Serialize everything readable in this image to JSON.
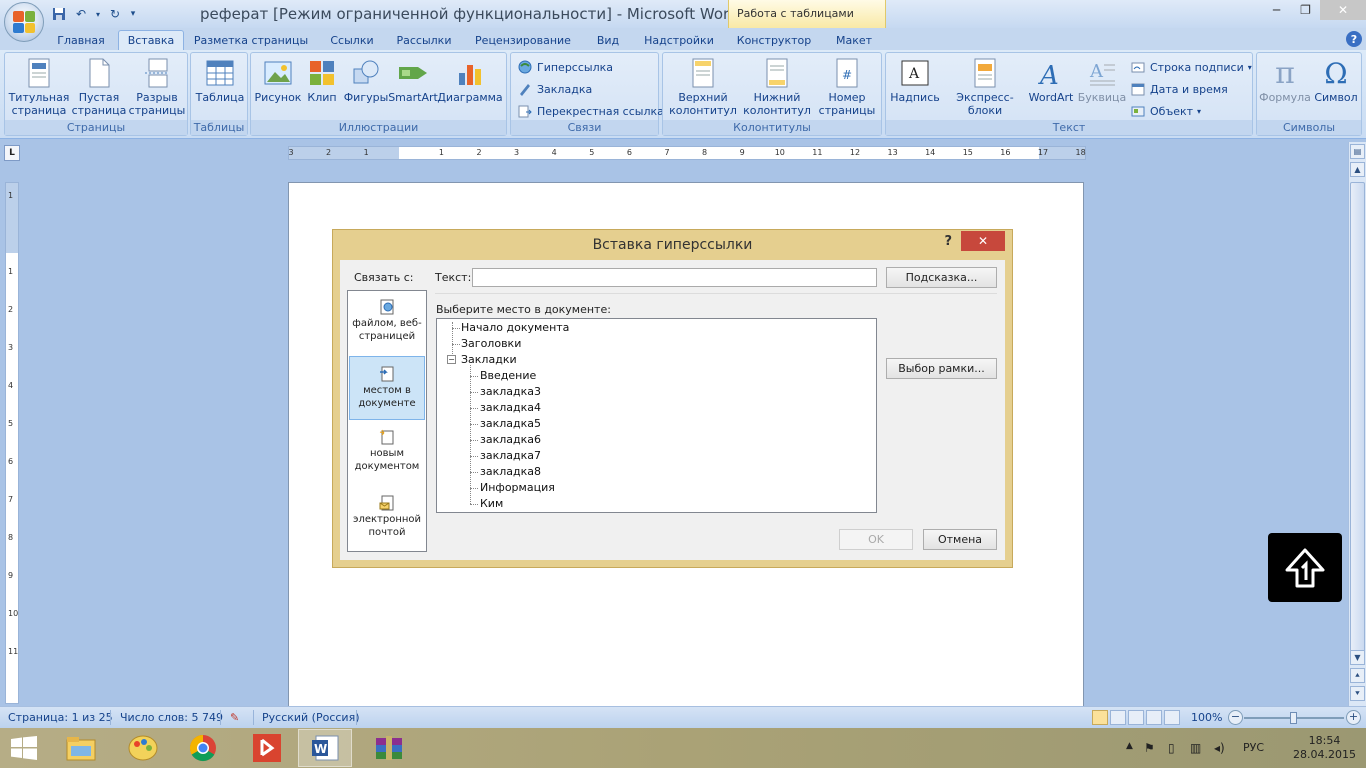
{
  "app": {
    "window_title": "реферат [Режим ограниченной функциональности]  -  Microsoft Word",
    "context_tab_group": "Работа с таблицами"
  },
  "tabs": [
    "Главная",
    "Вставка",
    "Разметка страницы",
    "Ссылки",
    "Рассылки",
    "Рецензирование",
    "Вид",
    "Надстройки",
    "Конструктор",
    "Макет"
  ],
  "ribbon": {
    "pages": {
      "label": "Страницы",
      "title_page": "Титульная\nстраница",
      "blank_page": "Пустая\nстраница",
      "page_break": "Разрыв\nстраницы"
    },
    "tables": {
      "label": "Таблицы",
      "table": "Таблица"
    },
    "illustrations": {
      "label": "Иллюстрации",
      "picture": "Рисунок",
      "clip": "Клип",
      "shapes": "Фигуры",
      "smartart": "SmartArt",
      "chart": "Диаграмма"
    },
    "links": {
      "label": "Связи",
      "hyperlink": "Гиперссылка",
      "bookmark": "Закладка",
      "cross_ref": "Перекрестная ссылка"
    },
    "header_footer": {
      "label": "Колонтитулы",
      "header": "Верхний\nколонтитул",
      "footer": "Нижний\nколонтитул",
      "page_number": "Номер\nстраницы"
    },
    "text": {
      "label": "Текст",
      "textbox": "Надпись",
      "quick_parts": "Экспресс-блоки",
      "wordart": "WordArt",
      "dropcap": "Буквица",
      "signature": "Строка подписи",
      "datetime": "Дата и время",
      "object": "Объект"
    },
    "symbols": {
      "label": "Символы",
      "equation": "Формула",
      "symbol": "Символ"
    }
  },
  "ruler": {
    "numbers": [
      "3",
      "2",
      "1",
      "",
      "1",
      "2",
      "3",
      "4",
      "5",
      "6",
      "7",
      "8",
      "9",
      "10",
      "11",
      "12",
      "13",
      "14",
      "15",
      "16",
      "17",
      "18"
    ]
  },
  "vruler": {
    "numbers": [
      "1",
      "",
      "1",
      "2",
      "3",
      "4",
      "5",
      "6",
      "7",
      "8",
      "9",
      "10",
      "11"
    ]
  },
  "dialog": {
    "title": "Вставка гиперссылки",
    "help": "?",
    "close": "✕",
    "link_to_label": "Связать с:",
    "text_label": "Текст:",
    "text_value": "",
    "hint_button": "Подсказка...",
    "select_place_label": "Выберите место в документе:",
    "frame_button": "Выбор рамки...",
    "ok_button": "OK",
    "cancel_button": "Отмена",
    "link_options": [
      {
        "label": "файлом, веб-\nстраницей",
        "selected": false
      },
      {
        "label": "местом в\nдокументе",
        "selected": true
      },
      {
        "label": "новым\nдокументом",
        "selected": false
      },
      {
        "label": "электронной\nпочтой",
        "selected": false
      }
    ],
    "tree": {
      "top": [
        "Начало документа",
        "Заголовки",
        "Закладки"
      ],
      "bookmarks": [
        "Введение",
        "закладка3",
        "закладка4",
        "закладка5",
        "закладка6",
        "закладка7",
        "закладка8",
        "Информация",
        "Ким"
      ]
    }
  },
  "status": {
    "page": "Страница: 1 из 25",
    "words": "Число слов: 5 749",
    "language": "Русский (Россия)",
    "zoom": "100%",
    "zoom_level": 1.0
  },
  "taskbar": {
    "language": "РУС",
    "time": "18:54",
    "date": "28.04.2015"
  },
  "colors": {
    "ribbon_text": "#15428b",
    "dialog_frame": "#e5cf8f",
    "dialog_close": "#c7483c"
  }
}
